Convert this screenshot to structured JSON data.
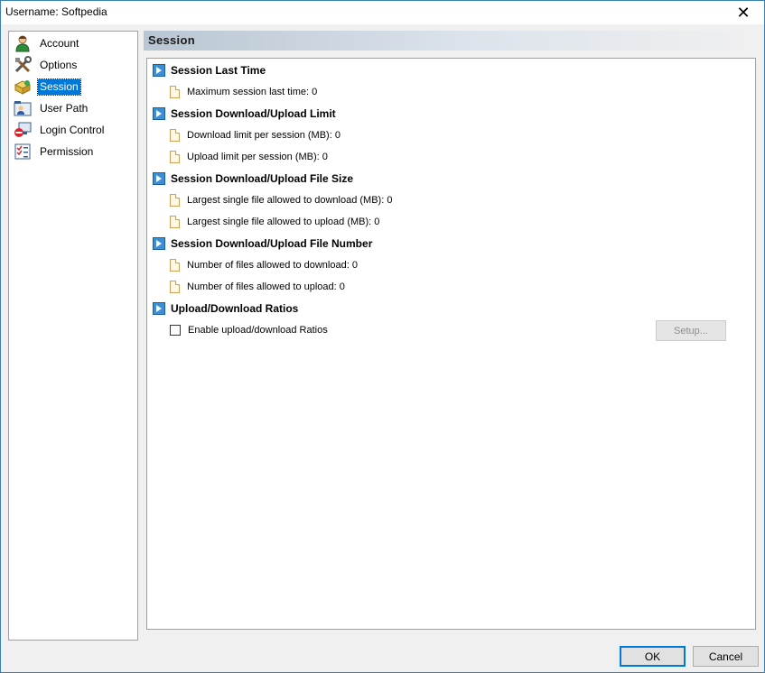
{
  "window": {
    "title": "Username: Softpedia",
    "close_glyph": "✕"
  },
  "nav": {
    "items": [
      {
        "label": "Account",
        "icon": "user-icon",
        "selected": false
      },
      {
        "label": "Options",
        "icon": "tools-icon",
        "selected": false
      },
      {
        "label": "Session",
        "icon": "session-icon",
        "selected": true
      },
      {
        "label": "User Path",
        "icon": "folder-user-icon",
        "selected": false
      },
      {
        "label": "Login Control",
        "icon": "login-control-icon",
        "selected": false
      },
      {
        "label": "Permission",
        "icon": "permission-icon",
        "selected": false
      }
    ]
  },
  "section": {
    "title": "Session"
  },
  "groups": [
    {
      "label": "Session Last Time",
      "items": [
        "Maximum session last time: 0"
      ]
    },
    {
      "label": "Session Download/Upload Limit",
      "items": [
        "Download limit per session (MB): 0",
        "Upload limit per session (MB): 0"
      ]
    },
    {
      "label": "Session Download/Upload File Size",
      "items": [
        "Largest single file allowed to download (MB): 0",
        "Largest single file allowed to upload (MB): 0"
      ]
    },
    {
      "label": "Session Download/Upload File Number",
      "items": [
        "Number of files allowed to download: 0",
        "Number of files allowed to upload: 0"
      ]
    },
    {
      "label": "Upload/Download Ratios",
      "checkbox_label": "Enable upload/download Ratios",
      "checkbox_checked": false,
      "setup_label": "Setup..."
    }
  ],
  "buttons": {
    "ok": "OK",
    "cancel": "Cancel"
  },
  "colors": {
    "selection": "#0078d7",
    "group_icon": "#3b8fd6"
  }
}
